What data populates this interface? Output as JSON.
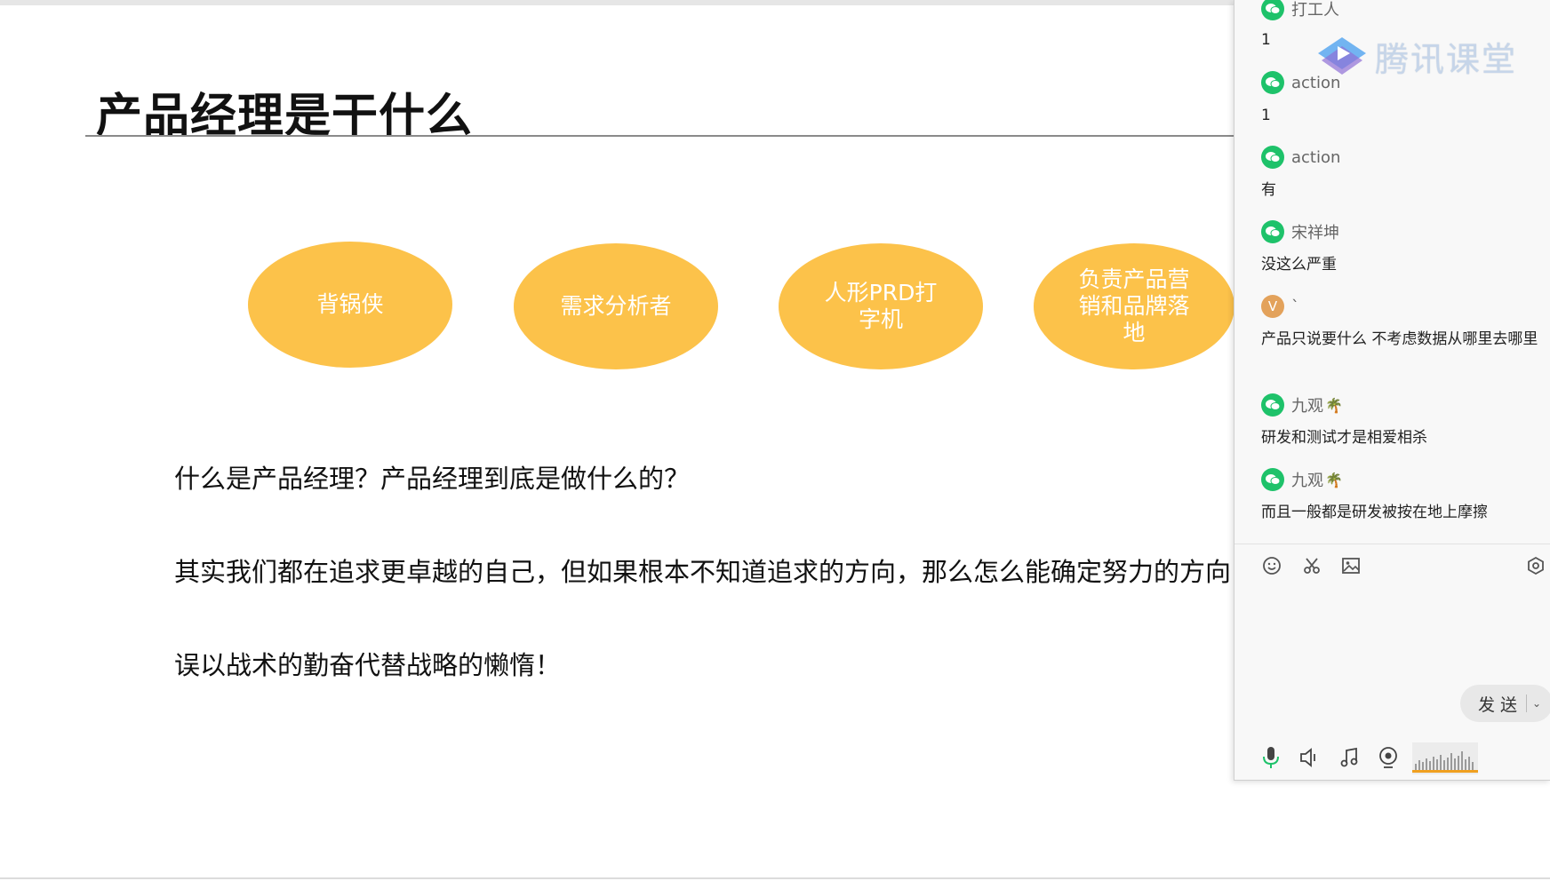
{
  "slide": {
    "title": "产品经理是干什么",
    "bubbles": [
      "背锅侠",
      "需求分析者",
      "人形PRD打字机",
      "负责产品营销和品牌落地"
    ],
    "lines": [
      "什么是产品经理？产品经理到底是做什么的？",
      "其实我们都在追求更卓越的自己，但如果根本不知道追求的方向，那么怎么能确定努力的方向",
      "误以战术的勤奋代替战略的懒惰！"
    ],
    "bubble_color": "#fcc24a"
  },
  "chat": {
    "watermark": "腾讯课堂",
    "messages": [
      {
        "user": "打工人",
        "text": "1"
      },
      {
        "user": "action",
        "text": "1"
      },
      {
        "user": "action",
        "text": "有"
      },
      {
        "user": "宋祥坤",
        "text": "没这么严重"
      },
      {
        "user": "`",
        "avatar": "V",
        "text": "产品只说要什么 不考虑数据从哪里去哪里"
      },
      {
        "user": "九观",
        "text": "研发和测试才是相爱相杀"
      },
      {
        "user": "九观",
        "text": "而且一般都是研发被按在地上摩擦"
      }
    ],
    "send_label": "发 送",
    "wechat_color": "#1ec26a",
    "tools": [
      "emoji-icon",
      "scissors-icon",
      "image-icon",
      "settings-hex-icon"
    ],
    "bottom_tools": [
      "microphone-icon",
      "speaker-icon",
      "music-icon",
      "camera-icon",
      "audio-level-meter"
    ]
  }
}
